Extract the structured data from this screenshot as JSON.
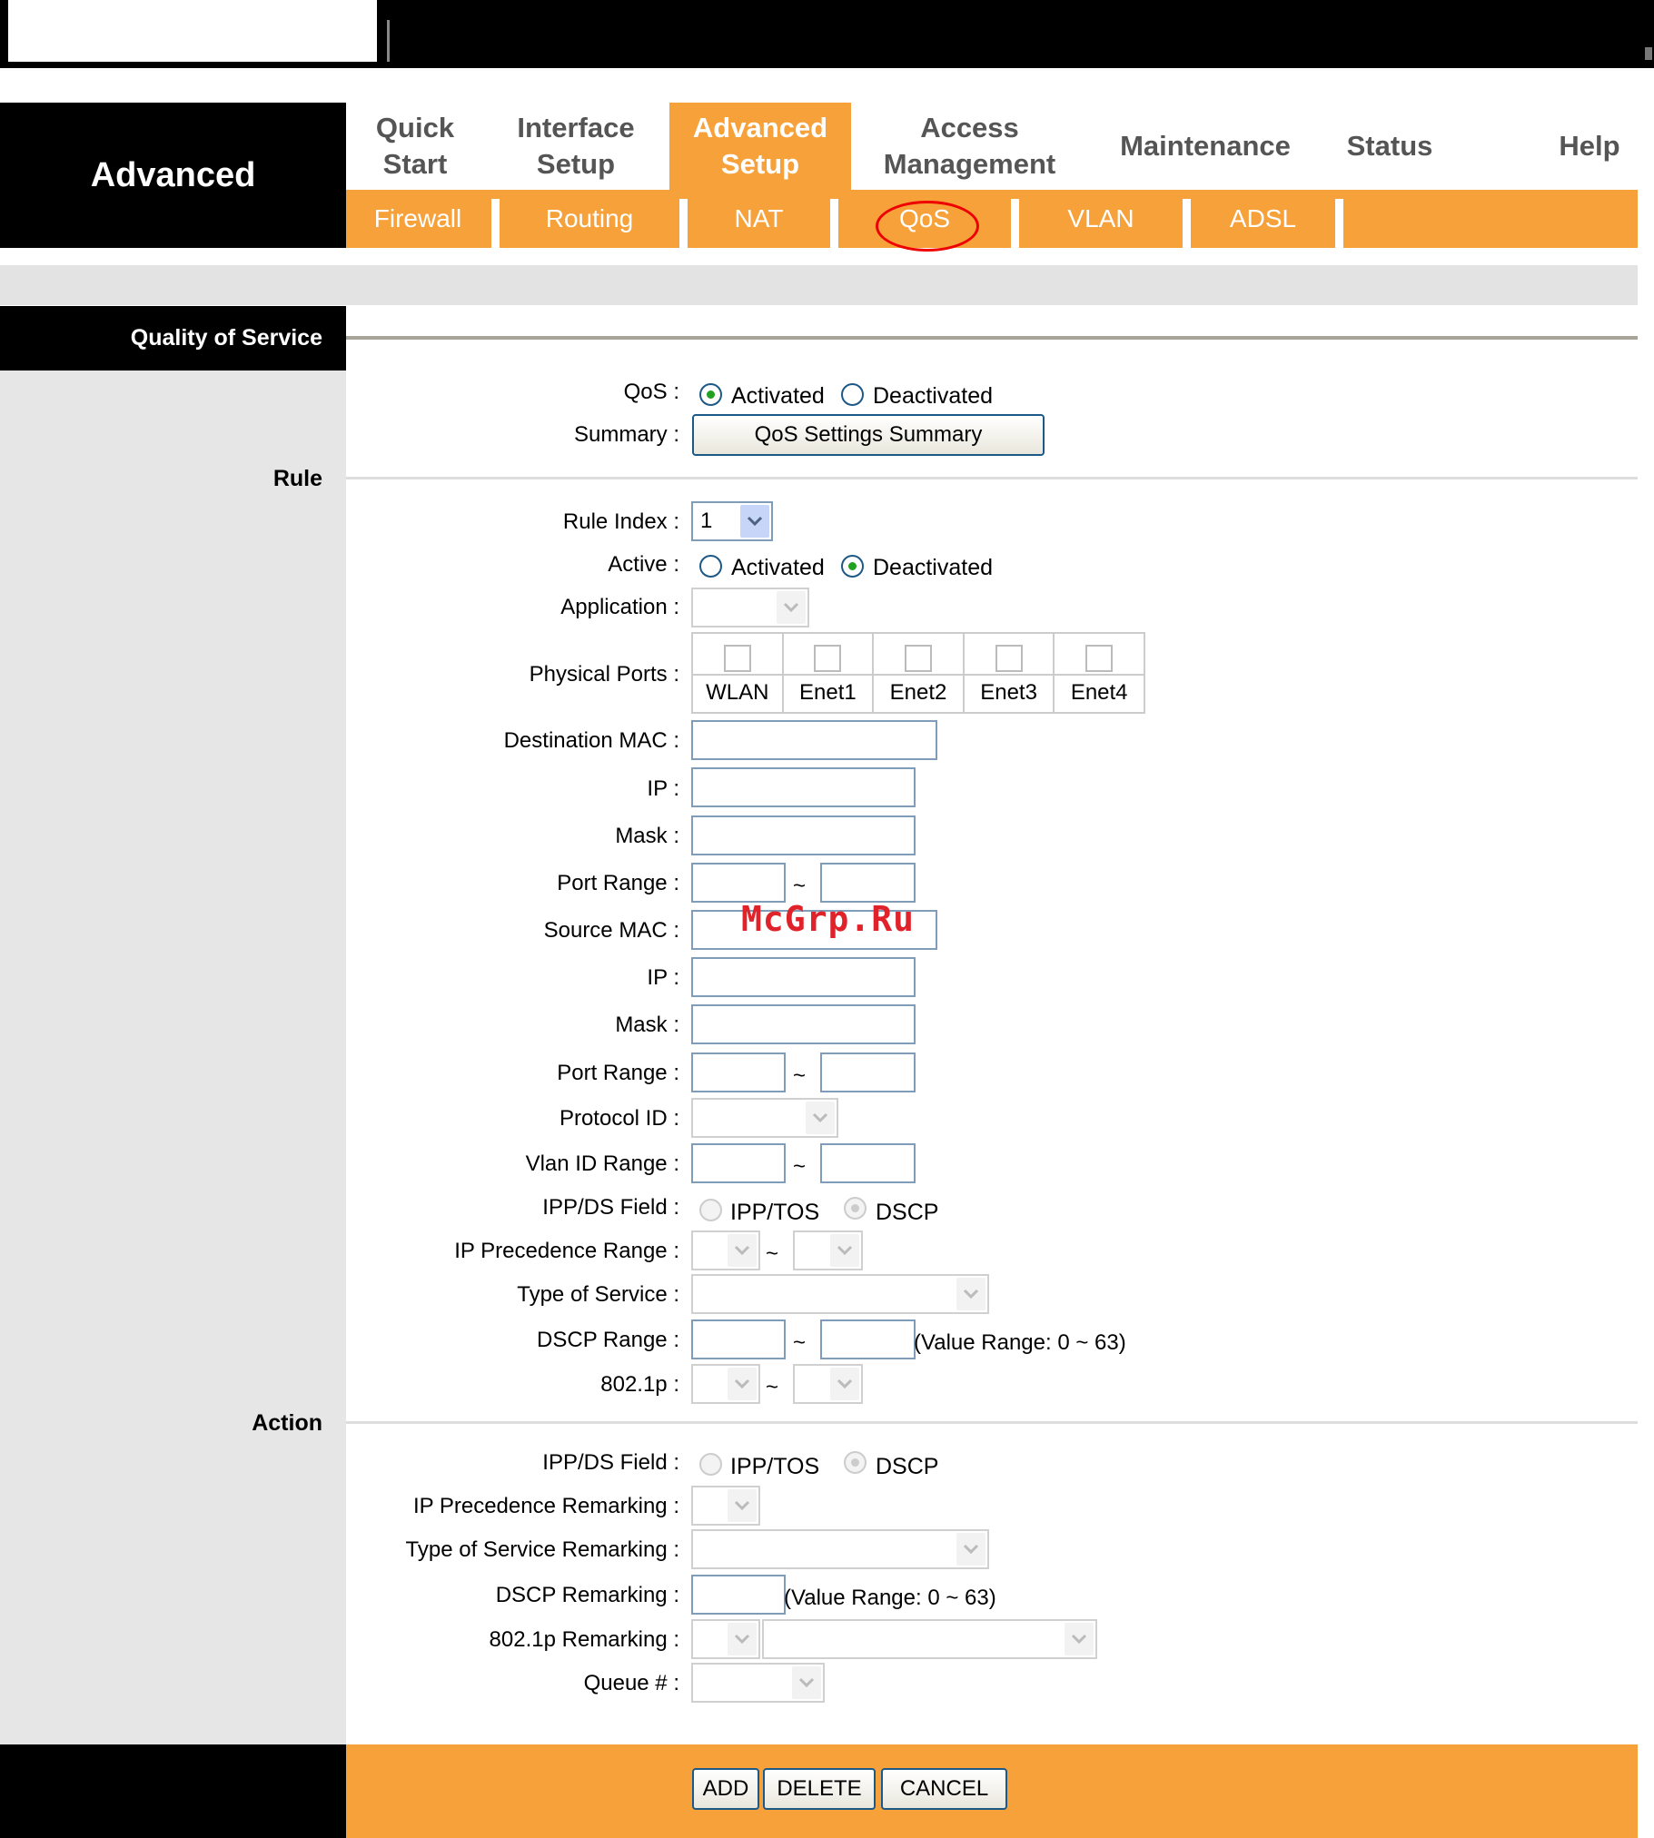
{
  "brand": "Advanced",
  "menu": [
    {
      "label": "Quick\nStart"
    },
    {
      "label": "Interface\nSetup"
    },
    {
      "label": "Advanced\nSetup"
    },
    {
      "label": "Access\nManagement"
    },
    {
      "label": "Maintenance"
    },
    {
      "label": "Status"
    },
    {
      "label": "Help"
    }
  ],
  "submenu": [
    "Firewall",
    "Routing",
    "NAT",
    "QoS",
    "VLAN",
    "ADSL"
  ],
  "section_title": "Quality of Service",
  "qos": {
    "label": "QoS :",
    "activated": "Activated",
    "deactivated": "Deactivated",
    "summary_label": "Summary :",
    "summary_button": "QoS Settings Summary"
  },
  "rule": {
    "heading": "Rule",
    "rule_index_label": "Rule Index :",
    "rule_index_value": "1",
    "active_label": "Active :",
    "active_activated": "Activated",
    "active_deactivated": "Deactivated",
    "application_label": "Application :",
    "physical_ports_label": "Physical Ports :",
    "ports": [
      "WLAN",
      "Enet1",
      "Enet2",
      "Enet3",
      "Enet4"
    ],
    "dest_mac_label": "Destination MAC :",
    "ip_label": "IP :",
    "mask_label": "Mask :",
    "port_range_label": "Port Range :",
    "source_mac_label": "Source MAC :",
    "protocol_id_label": "Protocol ID :",
    "vlan_id_range_label": "Vlan ID Range :",
    "ippds_label": "IPP/DS Field :",
    "ipptos": "IPP/TOS",
    "dscp": "DSCP",
    "ip_precedence_range_label": "IP Precedence Range :",
    "type_of_service_label": "Type of Service :",
    "dscp_range_label": "DSCP Range :",
    "value_range_note": "(Value Range: 0 ~ 63)",
    "dot1p_label": "802.1p :",
    "tilde": "~"
  },
  "action": {
    "heading": "Action",
    "ippds_label": "IPP/DS Field :",
    "ipptos": "IPP/TOS",
    "dscp": "DSCP",
    "ip_precedence_remarking_label": "IP Precedence Remarking :",
    "tos_remarking_label": "Type of Service Remarking :",
    "dscp_remarking_label": "DSCP Remarking :",
    "value_range_note": "(Value Range: 0 ~ 63)",
    "dot1p_remarking_label": "802.1p Remarking :",
    "queue_label": "Queue # :"
  },
  "buttons": {
    "add": "ADD",
    "delete": "DELETE",
    "cancel": "CANCEL"
  },
  "watermark": "McGrp.Ru",
  "colors": {
    "accent": "#f7a13b",
    "header": "#000000",
    "highlight_circle": "#e00000"
  }
}
